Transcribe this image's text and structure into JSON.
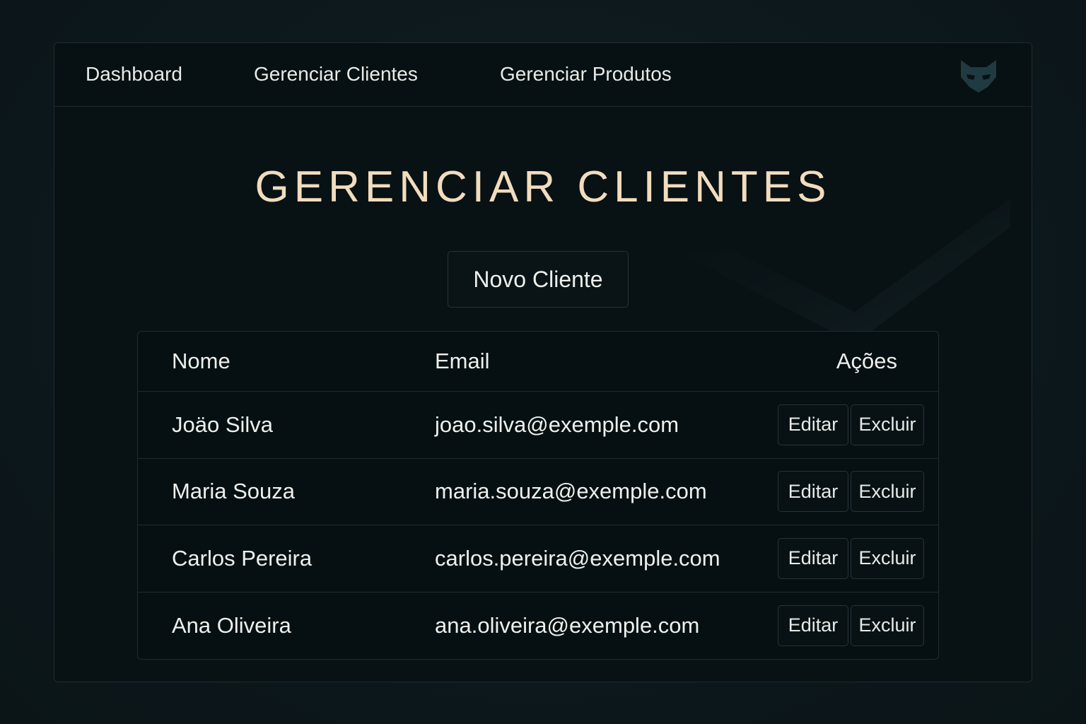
{
  "nav": {
    "items": [
      {
        "label": "Dashboard"
      },
      {
        "label": "Gerenciar Clientes"
      },
      {
        "label": "Gerenciar Produtos"
      }
    ],
    "logo_icon": "fox-mask-icon"
  },
  "page": {
    "title": "GERENCIAR CLIENTES",
    "new_button_label": "Novo Cliente"
  },
  "table": {
    "headers": {
      "name": "Nome",
      "email": "Email",
      "actions": "Ações"
    },
    "rows": [
      {
        "name": "Joäo Silva",
        "email": "joao.silva@exemple.com",
        "edit": "Editar",
        "delete": "Excluir"
      },
      {
        "name": "Maria Souza",
        "email": "maria.souza@exemple.com",
        "edit": "Editar",
        "delete": "Excluir"
      },
      {
        "name": "Carlos Pereira",
        "email": "carlos.pereira@exemple.com",
        "edit": "Editar",
        "delete": "Excluir"
      },
      {
        "name": "Ana Oliveira",
        "email": "ana.oliveira@exemple.com",
        "edit": "Editar",
        "delete": "Excluir"
      }
    ]
  },
  "colors": {
    "background": "#0b1518",
    "panel": "#081114",
    "title_accent": "#f1dcbd",
    "text": "#eef0ec",
    "border": "#1f2c30"
  }
}
